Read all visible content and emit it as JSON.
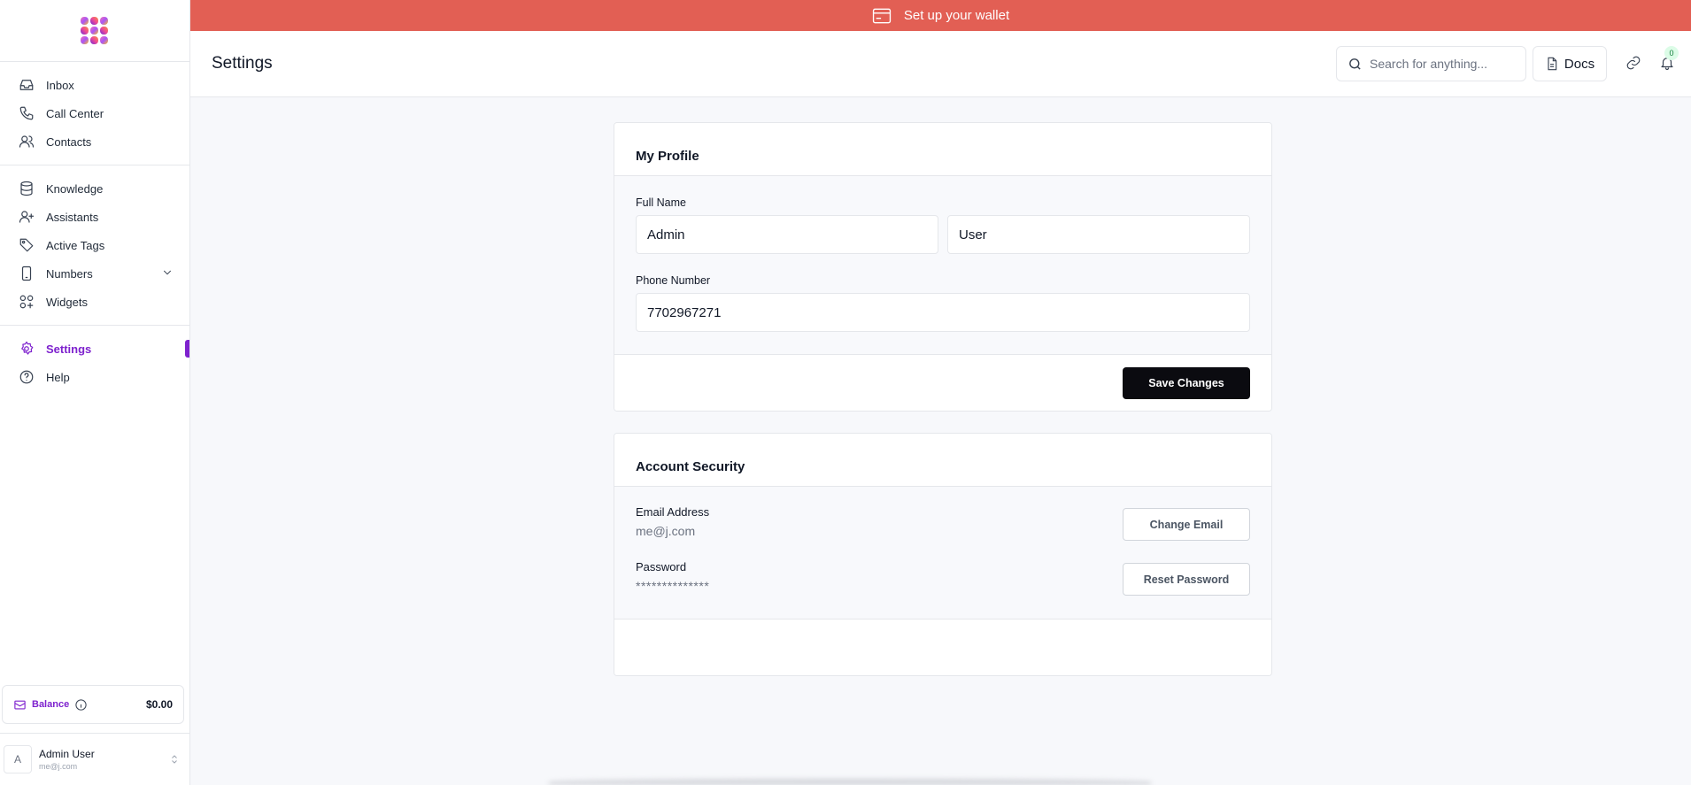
{
  "sidebar": {
    "groups": [
      [
        {
          "label": "Inbox",
          "icon": "inbox-icon"
        },
        {
          "label": "Call Center",
          "icon": "phone-icon"
        },
        {
          "label": "Contacts",
          "icon": "users-icon"
        }
      ],
      [
        {
          "label": "Knowledge",
          "icon": "database-icon"
        },
        {
          "label": "Assistants",
          "icon": "user-plus-icon"
        },
        {
          "label": "Active Tags",
          "icon": "tag-icon"
        },
        {
          "label": "Numbers",
          "icon": "smartphone-icon"
        },
        {
          "label": "Widgets",
          "icon": "grid-plus-icon"
        }
      ],
      [
        {
          "label": "Settings",
          "icon": "gear-icon"
        },
        {
          "label": "Help",
          "icon": "help-circle-icon"
        }
      ]
    ],
    "balance": {
      "label": "Balance",
      "amount": "$0.00"
    },
    "user": {
      "initial": "A",
      "name": "Admin User",
      "email": "me@j.com"
    }
  },
  "banner": {
    "text": "Set up your wallet"
  },
  "header": {
    "title": "Settings",
    "search_placeholder": "Search for anything...",
    "docs_label": "Docs",
    "notification_count": "0"
  },
  "profile": {
    "title": "My Profile",
    "full_name_label": "Full Name",
    "first_name": "Admin",
    "last_name": "User",
    "phone_label": "Phone Number",
    "phone": "7702967271",
    "save_label": "Save Changes"
  },
  "security": {
    "title": "Account Security",
    "email_label": "Email Address",
    "email": "me@j.com",
    "change_email_label": "Change Email",
    "password_label": "Password",
    "password_mask": "**************",
    "reset_password_label": "Reset Password"
  },
  "colors": {
    "accent": "#7e22ce",
    "banner": "#e25f54",
    "primary_button": "#0b0b10"
  }
}
